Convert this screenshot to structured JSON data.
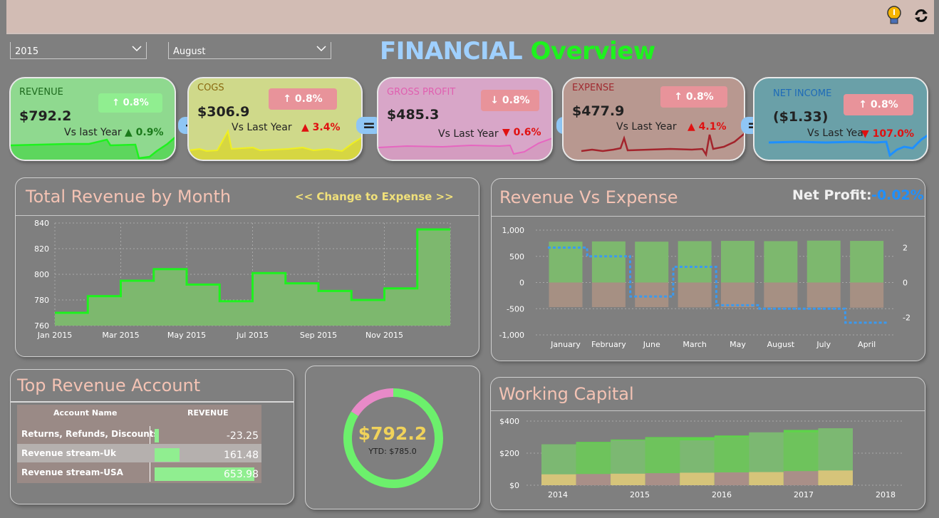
{
  "header": {
    "icons": [
      "lightbulb-icon",
      "refresh-icon"
    ]
  },
  "filters": {
    "year": "2015",
    "month": "August"
  },
  "title": {
    "part1": "FINANCIAL",
    "part2": "Overview",
    "color1": "#9fd0ff",
    "color2": "#1ef21e"
  },
  "kpis": [
    {
      "label": "REVENUE",
      "value": "$792.2",
      "badge": "↑ 0.8%",
      "vs": "Vs last Year",
      "change": "0.9%",
      "dir": "up",
      "label_color": "#1e6b1e",
      "bg": "#8fd98f",
      "badge_bg": "#90ee90",
      "change_color": "#1b7a1b",
      "line_color": "#1ef21e"
    },
    {
      "label": "COGS",
      "value": "$306.9",
      "badge": "↑ 0.8%",
      "vs": "Vs Last Year",
      "change": "3.4%",
      "dir": "up",
      "label_color": "#8a6a10",
      "bg": "#cfd98a",
      "badge_bg": "#e8939a",
      "change_color": "#e01010",
      "line_color": "#f0f020"
    },
    {
      "label": "GROSS PROFIT",
      "value": "$485.3",
      "badge": "↓ 0.8%",
      "vs": "Vs Last Year",
      "change": "0.6%",
      "dir": "down",
      "label_color": "#e060b0",
      "bg": "#d8a6c8",
      "badge_bg": "#e8939a",
      "change_color": "#e01010",
      "line_color": "#e666c0"
    },
    {
      "label": "EXPENSE",
      "value": "$477.9",
      "badge": "↑ 0.8%",
      "vs": "Vs Last Year",
      "change": "4.1%",
      "dir": "up",
      "label_color": "#a02a30",
      "bg": "#b89890",
      "badge_bg": "#e8939a",
      "change_color": "#e01010",
      "line_color": "#a3242c"
    },
    {
      "label": "NET INCOME",
      "value": "($1.33)",
      "badge": "↑ 0.8%",
      "vs": "Vs Last Year",
      "change": "107.0%",
      "dir": "down",
      "label_color": "#1e6bb8",
      "bg": "#6aa0a8",
      "badge_bg": "#e8939a",
      "change_color": "#e01010",
      "line_color": "#1e90ff"
    }
  ],
  "operators": [
    "−",
    "=",
    "−",
    "="
  ],
  "revenue_month": {
    "title": "Total Revenue by Month",
    "toggle": "<< Change to Expense >>",
    "chart_data": {
      "type": "area",
      "x": [
        "Jan 2015",
        "Feb 2015",
        "Mar 2015",
        "Apr 2015",
        "May 2015",
        "Jun 2015",
        "Jul 2015",
        "Aug 2015",
        "Sep 2015",
        "Oct 2015",
        "Nov 2015",
        "Dec 2015"
      ],
      "values": [
        770,
        783,
        795,
        804,
        792,
        779,
        801,
        793,
        787,
        780,
        789,
        835
      ],
      "xticks": [
        "Jan 2015",
        "Mar 2015",
        "May 2015",
        "Jul 2015",
        "Sep 2015",
        "Nov 2015"
      ],
      "yticks": [
        "840",
        "820",
        "800",
        "780",
        "760"
      ],
      "ylim": [
        760,
        840
      ],
      "line_color": "#1ef21e",
      "fill_color": "#7db86e"
    }
  },
  "rev_exp": {
    "title": "Revenue Vs Expense",
    "net_label": "Net Profit:",
    "net_value": "-0.02%",
    "chart_data": {
      "type": "bar",
      "categories": [
        "January",
        "February",
        "June",
        "March",
        "May",
        "August",
        "July",
        "April"
      ],
      "series": [
        {
          "values": [
            780,
            785,
            780,
            790,
            795,
            790,
            800,
            795
          ]
        },
        {
          "values": [
            -470,
            -470,
            -470,
            -475,
            -470,
            -475,
            -475,
            -480
          ]
        },
        {
          "values": [
            2.0,
            1.5,
            -0.8,
            0.9,
            -1.3,
            -1.5,
            -1.5,
            -2.3
          ]
        }
      ],
      "yticks_left": [
        "1,000",
        "500",
        "0",
        "-500",
        "-1,000"
      ],
      "yticks_right": [
        "2",
        "0",
        "-2"
      ],
      "ylim": [
        -1000,
        1000
      ],
      "ylim_right": [
        -3,
        3
      ]
    }
  },
  "top_account": {
    "title": "Top Revenue Account",
    "columns": [
      "Account Name",
      "REVENUE"
    ],
    "rows": [
      {
        "name": "Returns, Refunds, Discounts",
        "value": "-23.25",
        "bar": 0.04
      },
      {
        "name": "Revenue stream-Uk",
        "value": "161.48",
        "bar": 0.25
      },
      {
        "name": "Revenue stream-USA",
        "value": "653.98",
        "bar": 1.0
      }
    ]
  },
  "donut": {
    "value": "$792.2",
    "ytd": "YTD: $785.0",
    "chart_data": {
      "type": "pie",
      "values": [
        0.84,
        0.16
      ],
      "colors": [
        "#6cf06c",
        "#e88ac8"
      ]
    }
  },
  "working_capital": {
    "title": "Working Capital",
    "chart_data": {
      "type": "area",
      "x": [
        "2014",
        "2015",
        "2016",
        "2017",
        "2018"
      ],
      "yticks": [
        "$400",
        "$200",
        "$0"
      ],
      "ylim": [
        0,
        400
      ],
      "top": [
        255,
        270,
        285,
        300,
        300,
        310,
        320,
        345,
        355
      ],
      "bands": [
        {
          "color": "#6fc060",
          "values": [
            255,
            265,
            280,
            295,
            280,
            300,
            330,
            330,
            355
          ]
        },
        {
          "color": "#caa08a",
          "values": [
            68,
            70,
            72,
            75,
            78,
            80,
            82,
            88,
            92
          ]
        }
      ]
    }
  }
}
